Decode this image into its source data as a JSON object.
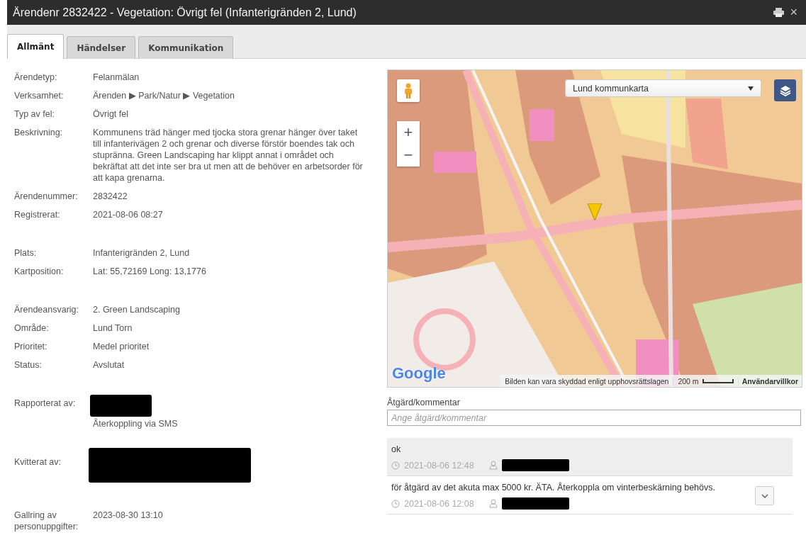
{
  "window": {
    "title": "Ärendenr 2832422 - Vegetation: Övrigt fel (Infanterigränden 2, Lund)",
    "close": "×"
  },
  "tabs": [
    {
      "label": "Allmänt",
      "selected": true
    },
    {
      "label": "Händelser",
      "selected": false
    },
    {
      "label": "Kommunikation",
      "selected": false
    }
  ],
  "field_groups": [
    [
      {
        "kind": "text",
        "label": "Ärendetyp:",
        "value": "Felanmälan"
      },
      {
        "kind": "text",
        "label": "Verksamhet:",
        "value": "Ärenden ▶ Park/Natur ▶ Vegetation"
      },
      {
        "kind": "text",
        "label": "Typ av fel:",
        "value": "Övrigt fel"
      },
      {
        "kind": "text",
        "label": "Beskrivning:",
        "value": "Kommunens träd hänger med tjocka stora grenar hänger över taket till infanterivägen 2 och grenar och diverse förstör boendes tak och stupränna. Green Landscaping har klippt annat i området och bekräftat att det inte ser bra ut men att de behöver en arbetsorder för att kapa grenarna."
      },
      {
        "kind": "text",
        "label": "Ärendenummer:",
        "value": "2832422"
      },
      {
        "kind": "text",
        "label": "Registrerat:",
        "value": "2021-08-06 08:27"
      }
    ],
    [
      {
        "kind": "text",
        "label": "Plats:",
        "value": "Infanterigränden 2, Lund"
      },
      {
        "kind": "text",
        "label": "Kartposition:",
        "value": "Lat: 55,72169 Long: 13,1776"
      }
    ],
    [
      {
        "kind": "text",
        "label": "Ärendeansvarig:",
        "value": "2. Green Landscaping"
      },
      {
        "kind": "text",
        "label": "Område:",
        "value": "Lund Torn"
      },
      {
        "kind": "text",
        "label": "Prioritet:",
        "value": "Medel prioritet"
      },
      {
        "kind": "text",
        "label": "Status:",
        "value": "Avslutat"
      }
    ],
    [
      {
        "kind": "redacted",
        "label": "Rapporterat av:",
        "note": "Återkoppling via SMS"
      }
    ],
    [
      {
        "kind": "redacted-large",
        "label": "Kvitterat av:"
      }
    ],
    [
      {
        "kind": "text",
        "label": "Gallring av personuppgifter:",
        "value": "2023-08-30 13:10"
      }
    ]
  ],
  "map": {
    "layer": "Lund kommunkarta",
    "logo": "Google",
    "attribution": "Bilden kan vara skyddad enligt upphovsrättslagen",
    "scale": "200 m",
    "terms": "Användarvillkor",
    "zoom_in": "+",
    "zoom_out": "−"
  },
  "comment": {
    "label": "Åtgärd/kommentar",
    "placeholder": "Ange åtgärd/kommentar"
  },
  "comments": [
    {
      "text": "ok",
      "time": "2021-08-06 12:48",
      "selected": true,
      "expandable": false
    },
    {
      "text": "för åtgärd av det akuta max 5000 kr. ÄTA. Återkoppla om vinterbeskärning behövs.",
      "time": "2021-08-06 12:08",
      "selected": false,
      "expandable": true
    }
  ]
}
